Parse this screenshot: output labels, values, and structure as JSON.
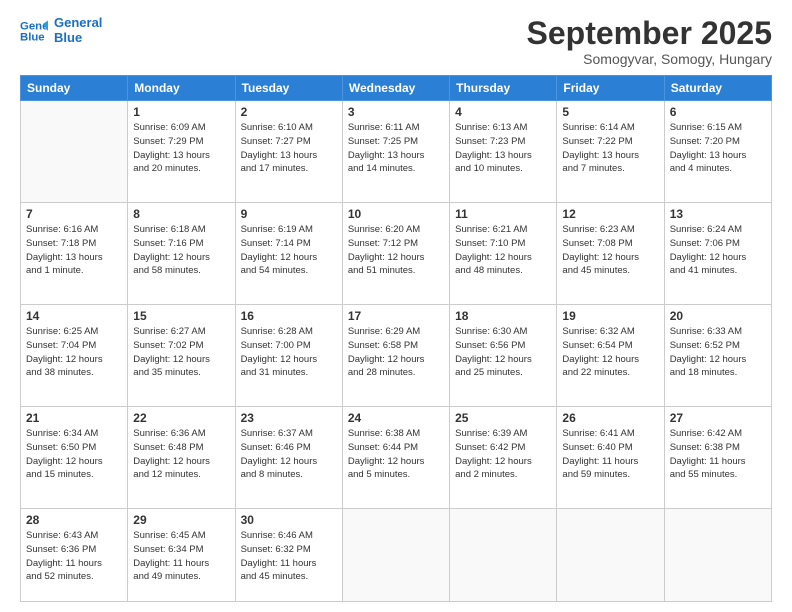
{
  "logo": {
    "line1": "General",
    "line2": "Blue"
  },
  "header": {
    "title": "September 2025",
    "location": "Somogyvar, Somogy, Hungary"
  },
  "days_of_week": [
    "Sunday",
    "Monday",
    "Tuesday",
    "Wednesday",
    "Thursday",
    "Friday",
    "Saturday"
  ],
  "weeks": [
    [
      {
        "day": "",
        "info": ""
      },
      {
        "day": "1",
        "info": "Sunrise: 6:09 AM\nSunset: 7:29 PM\nDaylight: 13 hours\nand 20 minutes."
      },
      {
        "day": "2",
        "info": "Sunrise: 6:10 AM\nSunset: 7:27 PM\nDaylight: 13 hours\nand 17 minutes."
      },
      {
        "day": "3",
        "info": "Sunrise: 6:11 AM\nSunset: 7:25 PM\nDaylight: 13 hours\nand 14 minutes."
      },
      {
        "day": "4",
        "info": "Sunrise: 6:13 AM\nSunset: 7:23 PM\nDaylight: 13 hours\nand 10 minutes."
      },
      {
        "day": "5",
        "info": "Sunrise: 6:14 AM\nSunset: 7:22 PM\nDaylight: 13 hours\nand 7 minutes."
      },
      {
        "day": "6",
        "info": "Sunrise: 6:15 AM\nSunset: 7:20 PM\nDaylight: 13 hours\nand 4 minutes."
      }
    ],
    [
      {
        "day": "7",
        "info": "Sunrise: 6:16 AM\nSunset: 7:18 PM\nDaylight: 13 hours\nand 1 minute."
      },
      {
        "day": "8",
        "info": "Sunrise: 6:18 AM\nSunset: 7:16 PM\nDaylight: 12 hours\nand 58 minutes."
      },
      {
        "day": "9",
        "info": "Sunrise: 6:19 AM\nSunset: 7:14 PM\nDaylight: 12 hours\nand 54 minutes."
      },
      {
        "day": "10",
        "info": "Sunrise: 6:20 AM\nSunset: 7:12 PM\nDaylight: 12 hours\nand 51 minutes."
      },
      {
        "day": "11",
        "info": "Sunrise: 6:21 AM\nSunset: 7:10 PM\nDaylight: 12 hours\nand 48 minutes."
      },
      {
        "day": "12",
        "info": "Sunrise: 6:23 AM\nSunset: 7:08 PM\nDaylight: 12 hours\nand 45 minutes."
      },
      {
        "day": "13",
        "info": "Sunrise: 6:24 AM\nSunset: 7:06 PM\nDaylight: 12 hours\nand 41 minutes."
      }
    ],
    [
      {
        "day": "14",
        "info": "Sunrise: 6:25 AM\nSunset: 7:04 PM\nDaylight: 12 hours\nand 38 minutes."
      },
      {
        "day": "15",
        "info": "Sunrise: 6:27 AM\nSunset: 7:02 PM\nDaylight: 12 hours\nand 35 minutes."
      },
      {
        "day": "16",
        "info": "Sunrise: 6:28 AM\nSunset: 7:00 PM\nDaylight: 12 hours\nand 31 minutes."
      },
      {
        "day": "17",
        "info": "Sunrise: 6:29 AM\nSunset: 6:58 PM\nDaylight: 12 hours\nand 28 minutes."
      },
      {
        "day": "18",
        "info": "Sunrise: 6:30 AM\nSunset: 6:56 PM\nDaylight: 12 hours\nand 25 minutes."
      },
      {
        "day": "19",
        "info": "Sunrise: 6:32 AM\nSunset: 6:54 PM\nDaylight: 12 hours\nand 22 minutes."
      },
      {
        "day": "20",
        "info": "Sunrise: 6:33 AM\nSunset: 6:52 PM\nDaylight: 12 hours\nand 18 minutes."
      }
    ],
    [
      {
        "day": "21",
        "info": "Sunrise: 6:34 AM\nSunset: 6:50 PM\nDaylight: 12 hours\nand 15 minutes."
      },
      {
        "day": "22",
        "info": "Sunrise: 6:36 AM\nSunset: 6:48 PM\nDaylight: 12 hours\nand 12 minutes."
      },
      {
        "day": "23",
        "info": "Sunrise: 6:37 AM\nSunset: 6:46 PM\nDaylight: 12 hours\nand 8 minutes."
      },
      {
        "day": "24",
        "info": "Sunrise: 6:38 AM\nSunset: 6:44 PM\nDaylight: 12 hours\nand 5 minutes."
      },
      {
        "day": "25",
        "info": "Sunrise: 6:39 AM\nSunset: 6:42 PM\nDaylight: 12 hours\nand 2 minutes."
      },
      {
        "day": "26",
        "info": "Sunrise: 6:41 AM\nSunset: 6:40 PM\nDaylight: 11 hours\nand 59 minutes."
      },
      {
        "day": "27",
        "info": "Sunrise: 6:42 AM\nSunset: 6:38 PM\nDaylight: 11 hours\nand 55 minutes."
      }
    ],
    [
      {
        "day": "28",
        "info": "Sunrise: 6:43 AM\nSunset: 6:36 PM\nDaylight: 11 hours\nand 52 minutes."
      },
      {
        "day": "29",
        "info": "Sunrise: 6:45 AM\nSunset: 6:34 PM\nDaylight: 11 hours\nand 49 minutes."
      },
      {
        "day": "30",
        "info": "Sunrise: 6:46 AM\nSunset: 6:32 PM\nDaylight: 11 hours\nand 45 minutes."
      },
      {
        "day": "",
        "info": ""
      },
      {
        "day": "",
        "info": ""
      },
      {
        "day": "",
        "info": ""
      },
      {
        "day": "",
        "info": ""
      }
    ]
  ]
}
